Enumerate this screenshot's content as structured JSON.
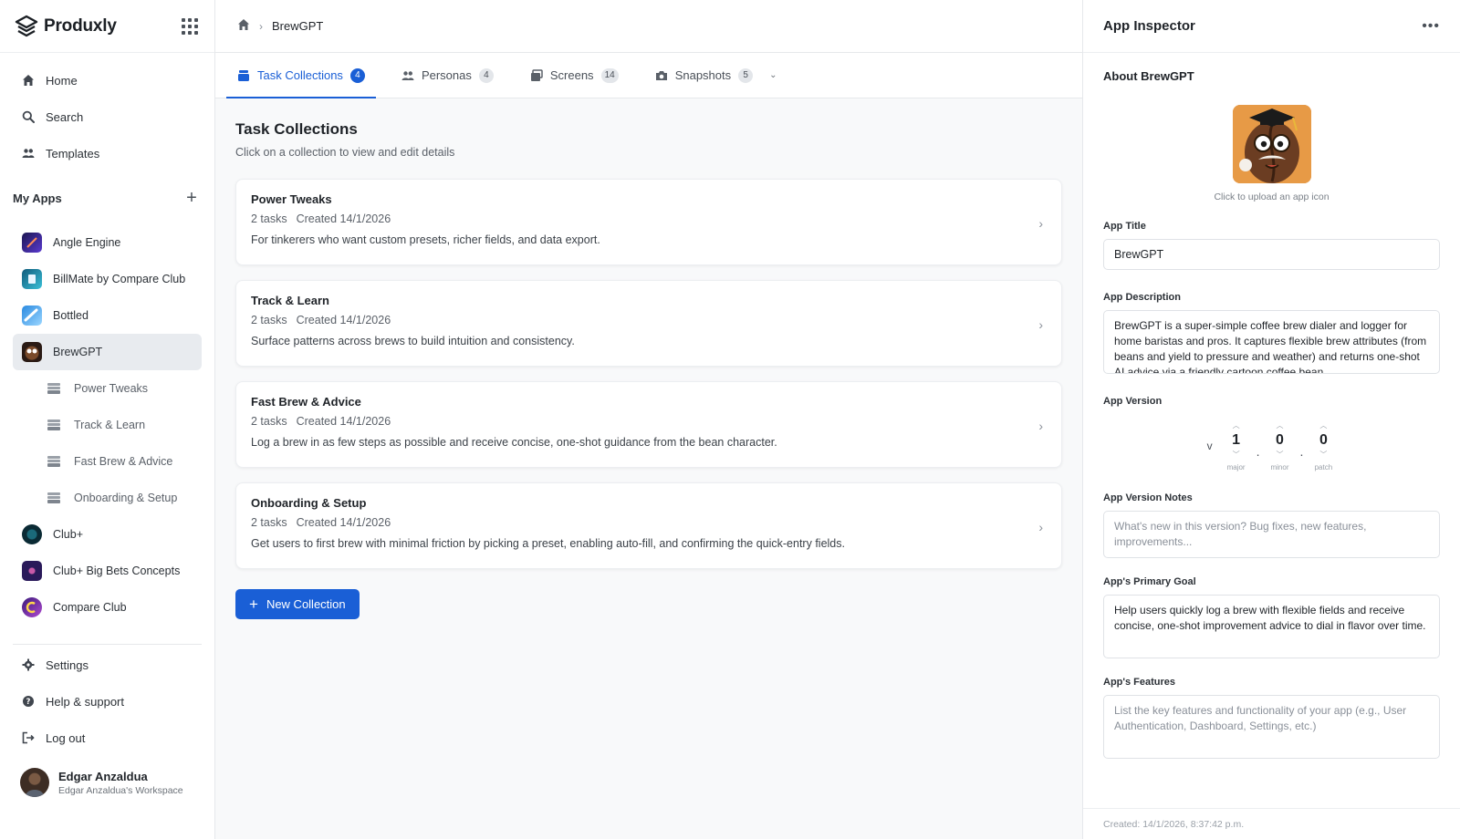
{
  "brand": {
    "name": "Produxly",
    "logo_icon": "layers-logo-icon",
    "apps_icon": "grid-icon"
  },
  "nav": [
    {
      "label": "Home",
      "icon": "home-icon"
    },
    {
      "label": "Search",
      "icon": "search-icon"
    },
    {
      "label": "Templates",
      "icon": "people-icon"
    }
  ],
  "my_apps": {
    "label": "My Apps",
    "add_icon": "plus-icon",
    "items": [
      {
        "label": "Angle Engine",
        "color": "#3a2a8a"
      },
      {
        "label": "BillMate by Compare Club",
        "color": "#1f8aa8"
      },
      {
        "label": "Bottled",
        "color": "#4aa8e8"
      },
      {
        "label": "BrewGPT",
        "color": "#7a4a2a"
      },
      {
        "label": "Club+",
        "color": "#0f4a5a"
      },
      {
        "label": "Club+ Big Bets Concepts",
        "color": "#2a1a5a"
      },
      {
        "label": "Compare Club",
        "color": "#6a2a9a"
      }
    ],
    "sub_items": [
      "Power Tweaks",
      "Track & Learn",
      "Fast Brew & Advice",
      "Onboarding & Setup"
    ]
  },
  "bottom_nav": [
    {
      "label": "Settings",
      "icon": "gear-icon"
    },
    {
      "label": "Help & support",
      "icon": "help-icon"
    },
    {
      "label": "Log out",
      "icon": "logout-icon"
    }
  ],
  "user": {
    "name": "Edgar Anzaldua",
    "workspace": "Edgar Anzaldua's Workspace"
  },
  "breadcrumb": {
    "current": "BrewGPT"
  },
  "tabs": [
    {
      "label": "Task Collections",
      "count": "4",
      "icon": "collections-icon"
    },
    {
      "label": "Personas",
      "count": "4",
      "icon": "people-icon"
    },
    {
      "label": "Screens",
      "count": "14",
      "icon": "screens-icon"
    },
    {
      "label": "Snapshots",
      "count": "5",
      "icon": "camera-icon"
    }
  ],
  "main": {
    "title": "Task Collections",
    "subtitle": "Click on a collection to view and edit details",
    "collections": [
      {
        "title": "Power Tweaks",
        "tasks": "2 tasks",
        "created": "Created 14/1/2026",
        "description": "For tinkerers who want custom presets, richer fields, and data export."
      },
      {
        "title": "Track & Learn",
        "tasks": "2 tasks",
        "created": "Created 14/1/2026",
        "description": "Surface patterns across brews to build intuition and consistency."
      },
      {
        "title": "Fast Brew & Advice",
        "tasks": "2 tasks",
        "created": "Created 14/1/2026",
        "description": "Log a brew in as few steps as possible and receive concise, one-shot guidance from the bean character."
      },
      {
        "title": "Onboarding & Setup",
        "tasks": "2 tasks",
        "created": "Created 14/1/2026",
        "description": "Get users to first brew with minimal friction by picking a preset, enabling auto-fill, and confirming the quick-entry fields."
      }
    ],
    "new_button": "New Collection"
  },
  "inspector": {
    "title": "App Inspector",
    "about": "About BrewGPT",
    "upload_hint": "Click to upload an app icon",
    "app_title_label": "App Title",
    "app_title": "BrewGPT",
    "app_description_label": "App Description",
    "app_description": "BrewGPT is a super-simple coffee brew dialer and logger for home baristas and pros. It captures flexible brew attributes (from beans and yield to pressure and weather) and returns one-shot AI advice via a friendly cartoon coffee bean.",
    "version_label": "App Version",
    "version": {
      "prefix": "v",
      "major": "1",
      "minor": "0",
      "patch": "0",
      "major_label": "major",
      "minor_label": "minor",
      "patch_label": "patch"
    },
    "version_notes_label": "App Version Notes",
    "version_notes_placeholder": "What's new in this version? Bug fixes, new features, improvements...",
    "goal_label": "App's Primary Goal",
    "goal": "Help users quickly log a brew with flexible fields and receive concise, one-shot improvement advice to dial in flavor over time.",
    "features_label": "App's Features",
    "features_placeholder": "List the key features and functionality of your app (e.g., User Authentication, Dashboard, Settings, etc.)",
    "created": "Created: 14/1/2026, 8:37:42 p.m."
  },
  "colors": {
    "accent": "#1a5fd6",
    "active_bg": "#e8ebef"
  }
}
